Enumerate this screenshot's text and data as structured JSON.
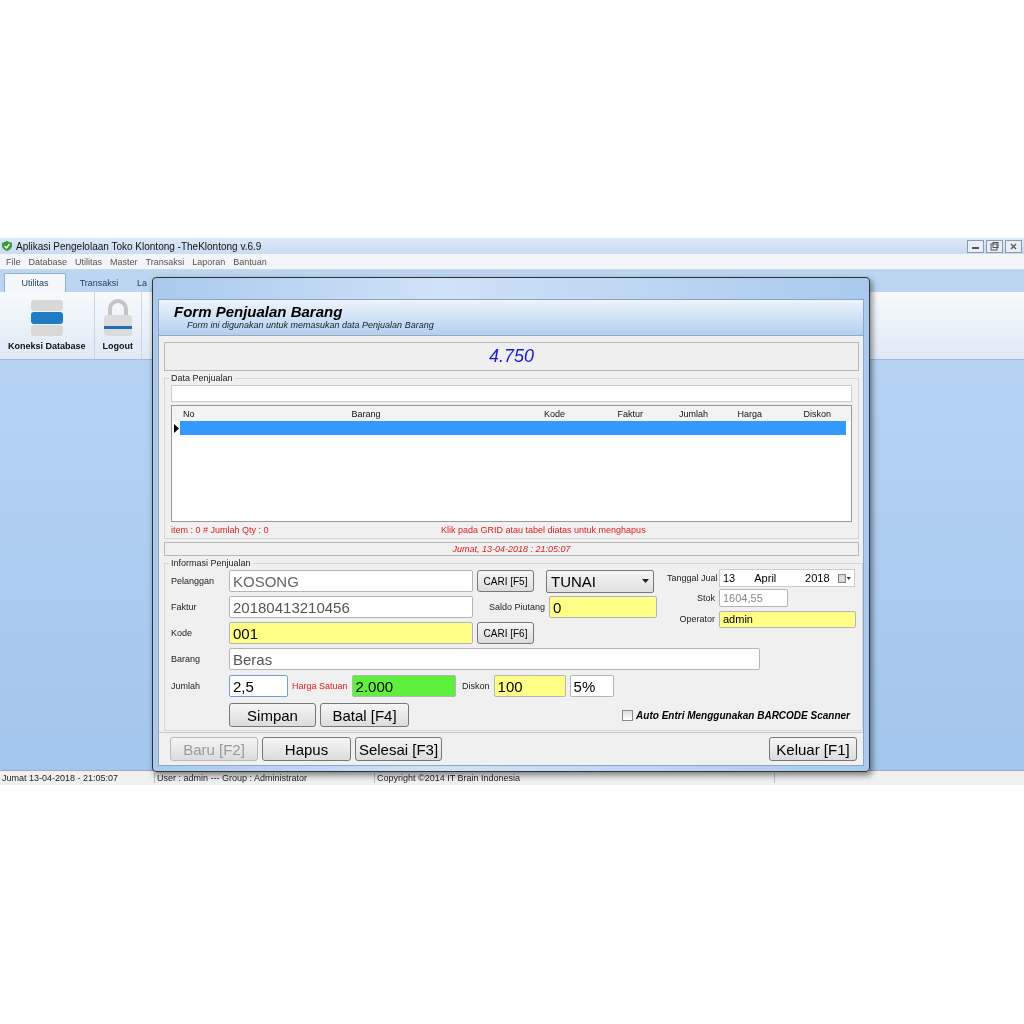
{
  "window": {
    "title": "Aplikasi Pengelolaan Toko Klontong -TheKlontong v.6.9"
  },
  "menu": [
    "File",
    "Database",
    "Utilitas",
    "Master",
    "Transaksi",
    "Laporan",
    "Bantuan"
  ],
  "ribbon_tabs": [
    {
      "label": "Utilitas",
      "selected": true
    },
    {
      "label": "Transaksi",
      "selected": false
    },
    {
      "label": "La",
      "selected": false
    }
  ],
  "ribbon_buttons": [
    {
      "label": "Koneksi Database",
      "kind": "database"
    },
    {
      "label": "Logout",
      "kind": "lock"
    }
  ],
  "dialog": {
    "title": "Form Penjualan Barang",
    "subtitle": "Form ini digunakan untuk memasukan data  Penjualan Barang",
    "total": "4.750",
    "data_group": {
      "label": "Data Penjualan",
      "table": {
        "columns": [
          "No",
          "Barang",
          "Kode",
          "Faktur",
          "Jumlah",
          "Harga",
          "Diskon"
        ],
        "rows": [
          {
            "selected": true
          }
        ]
      },
      "item_summary": "item : 0 # Jumlah Qty : 0",
      "hint": "Klik pada GRID atau tabel diatas untuk menghapus"
    },
    "datetime": "Jumat, 13-04-2018 : 21:05:07",
    "info_group": {
      "label": "Informasi Penjualan",
      "pelanggan": {
        "label": "Pelanggan",
        "value": "KOSONG",
        "button": "CARI [F5]"
      },
      "payment": {
        "value": "TUNAI"
      },
      "faktur": {
        "label": "Faktur",
        "value": "20180413210456"
      },
      "saldo_piutang": {
        "label": "Saldo Piutang",
        "value": "0"
      },
      "kode": {
        "label": "Kode",
        "value": "001",
        "button": "CARI [F6]"
      },
      "tanggal_jual": {
        "label": "Tanggal Jual",
        "day": "13",
        "month": "April",
        "year": "2018"
      },
      "stok": {
        "label": "Stok",
        "value": "1604,55",
        "disabled": true
      },
      "operator": {
        "label": "Operator",
        "value": "admin"
      },
      "barang": {
        "label": "Barang",
        "value": "Beras"
      },
      "jumlah": {
        "label": "Jumlah",
        "value": "2,5"
      },
      "harga_satuan": {
        "label": "Harga Satuan",
        "value": "2.000"
      },
      "diskon": {
        "label": "Diskon",
        "value": "100",
        "percent": "5%"
      },
      "actions": [
        {
          "label": "Simpan"
        },
        {
          "label": "Batal [F4]"
        }
      ],
      "barcode": {
        "label": "Auto Entri Menggunakan BARCODE Scanner",
        "checked": false
      }
    },
    "buttons": [
      {
        "label": "Baru [F2]",
        "disabled": true
      },
      {
        "label": "Hapus",
        "disabled": false
      },
      {
        "label": "Selesai [F3]",
        "disabled": false
      },
      {
        "label": "Keluar [F1]",
        "disabled": false
      }
    ]
  },
  "status_bar": [
    "Jumat 13-04-2018 - 21:05:07",
    "User : admin  --- Group : Administrator",
    "Copyright ©2014 IT Brain Indonesia"
  ]
}
